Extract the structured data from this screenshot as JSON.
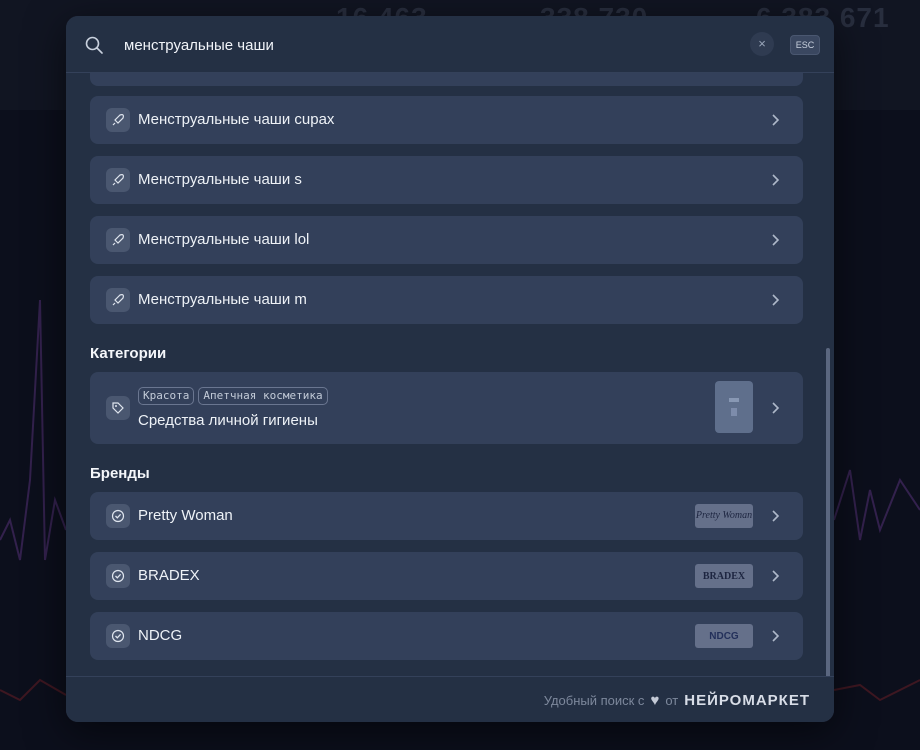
{
  "background": {
    "numbers": [
      "16 463",
      "338 730",
      "6 383 671"
    ]
  },
  "search": {
    "query": "менструальные чаши",
    "clear_glyph": "×",
    "esc_label": "ESC"
  },
  "suggestions": [
    {
      "label": "Менструальные чаши cupax",
      "icon": "rocket-icon"
    },
    {
      "label": "Менструальные чаши s",
      "icon": "rocket-icon"
    },
    {
      "label": "Менструальные чаши lol",
      "icon": "rocket-icon"
    },
    {
      "label": "Менструальные чаши m",
      "icon": "rocket-icon"
    }
  ],
  "categories": {
    "title": "Категории",
    "items": [
      {
        "tags": [
          "Красота",
          "Апетчная косметика"
        ],
        "label": "Средства личной гигиены",
        "icon": "tag-icon"
      }
    ]
  },
  "brands": {
    "title": "Бренды",
    "items": [
      {
        "label": "Pretty Woman",
        "logo_text": "Pretty Woman",
        "icon": "check-circle-icon"
      },
      {
        "label": "BRADEX",
        "logo_text": "BRADEX",
        "icon": "check-circle-icon"
      },
      {
        "label": "NDCG",
        "logo_text": "NDCG",
        "icon": "check-circle-icon"
      }
    ]
  },
  "footer": {
    "text_before": "Удобный поиск с",
    "text_after": "от",
    "brand": "НЕЙРОМАРКЕТ"
  },
  "colors": {
    "modal_bg": "#243044",
    "row_bg": "#33405a",
    "page_bg": "#0e1322"
  }
}
